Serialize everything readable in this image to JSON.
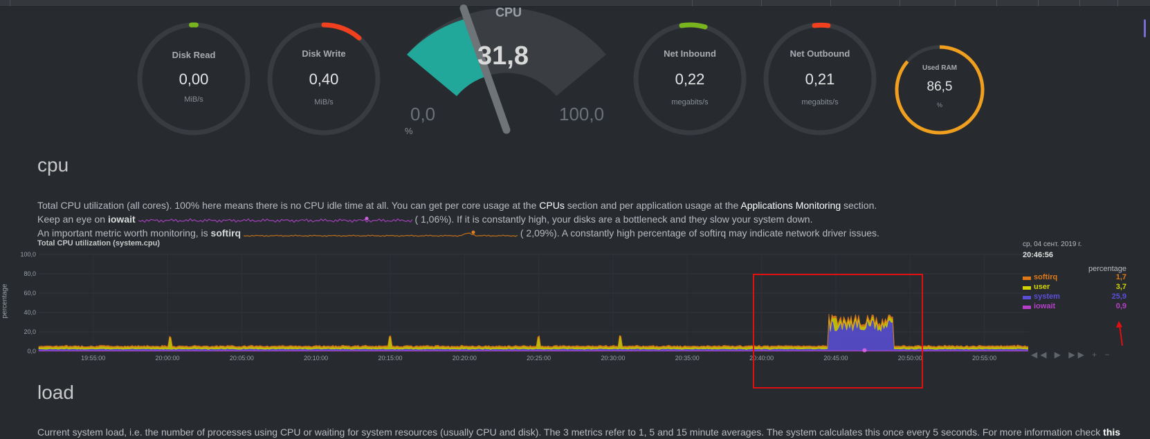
{
  "gauges": {
    "disk_read": {
      "title": "Disk Read",
      "value": "0,00",
      "unit": "MiB/s"
    },
    "disk_write": {
      "title": "Disk Write",
      "value": "0,40",
      "unit": "MiB/s"
    },
    "net_inbound": {
      "title": "Net Inbound",
      "value": "0,22",
      "unit": "megabits/s"
    },
    "net_outbound": {
      "title": "Net Outbound",
      "value": "0,21",
      "unit": "megabits/s"
    },
    "used_ram": {
      "title": "Used RAM",
      "value": "86,5",
      "unit": "%",
      "fraction": 0.865
    }
  },
  "cpu_gauge": {
    "title": "CPU",
    "value": "31,8",
    "min": "0,0",
    "max": "100,0",
    "unit": "%",
    "fraction": 0.318
  },
  "cpu_section": {
    "heading": "cpu",
    "line1_a": "Total CPU utilization (all cores). 100% here means there is no CPU idle time at all. You can get per core usage at the ",
    "line1_link1": "CPUs",
    "line1_b": " section and per application usage at the ",
    "line1_link2": "Applications Monitoring",
    "line1_c": " section.",
    "line2_a": "Keep an eye on ",
    "line2_key": "iowait",
    "line2_val": "(      1,06%). If it is constantly high, your disks are a bottleneck and they slow your system down.",
    "line3_a": "An important metric worth monitoring, is ",
    "line3_key": "softirq",
    "line3_val": "(      2,09%). A constantly high percentage of softirq may indicate network driver issues."
  },
  "chart_meta": {
    "title": "Total CPU utilization (system.cpu)"
  },
  "legend": {
    "date": "ср, 04 сент. 2019 г.",
    "time": "20:46:56",
    "header": "percentage",
    "items": [
      {
        "name": "softirq",
        "value": "1,7",
        "color": "#e07a16"
      },
      {
        "name": "user",
        "value": "3,7",
        "color": "#d4d400"
      },
      {
        "name": "system",
        "value": "25,9",
        "color": "#5b4fd8"
      },
      {
        "name": "iowait",
        "value": "0,9",
        "color": "#b540c8"
      }
    ]
  },
  "load_section": {
    "heading": "load",
    "text": "Current system load, i.e. the number of processes using CPU or waiting for system resources (usually CPU and disk). The 3 metrics refer to 1, 5 and 15 minute averages. The system calculates this once every 5 seconds. For more information check ",
    "link": "this"
  },
  "controls": "◀◀ ▶ ▶▶ + −",
  "chart_data": {
    "type": "area",
    "title": "Total CPU utilization (system.cpu)",
    "ylabel": "percentage",
    "ylim": [
      0,
      100
    ],
    "yticks": [
      "100,0",
      "80,0",
      "60,0",
      "40,0",
      "20,0",
      "0,0"
    ],
    "xticks": [
      "19:55:00",
      "20:00:00",
      "20:05:00",
      "20:10:00",
      "20:15:00",
      "20:20:00",
      "20:25:00",
      "20:30:00",
      "20:35:00",
      "20:40:00",
      "20:45:00",
      "20:50:00",
      "20:55:00"
    ],
    "series": [
      {
        "name": "iowait",
        "color": "#b540c8",
        "baseline": 0.9,
        "burst": 0.9
      },
      {
        "name": "system",
        "color": "#5b4fd8",
        "baseline": 1.5,
        "burst": 25.9
      },
      {
        "name": "user",
        "color": "#d4d400",
        "baseline": 2.0,
        "burst": 3.7
      },
      {
        "name": "softirq",
        "color": "#e07a16",
        "baseline": 1.0,
        "burst": 1.7
      }
    ],
    "burst_start": "20:44:30",
    "burst_end": "20:48:50"
  }
}
